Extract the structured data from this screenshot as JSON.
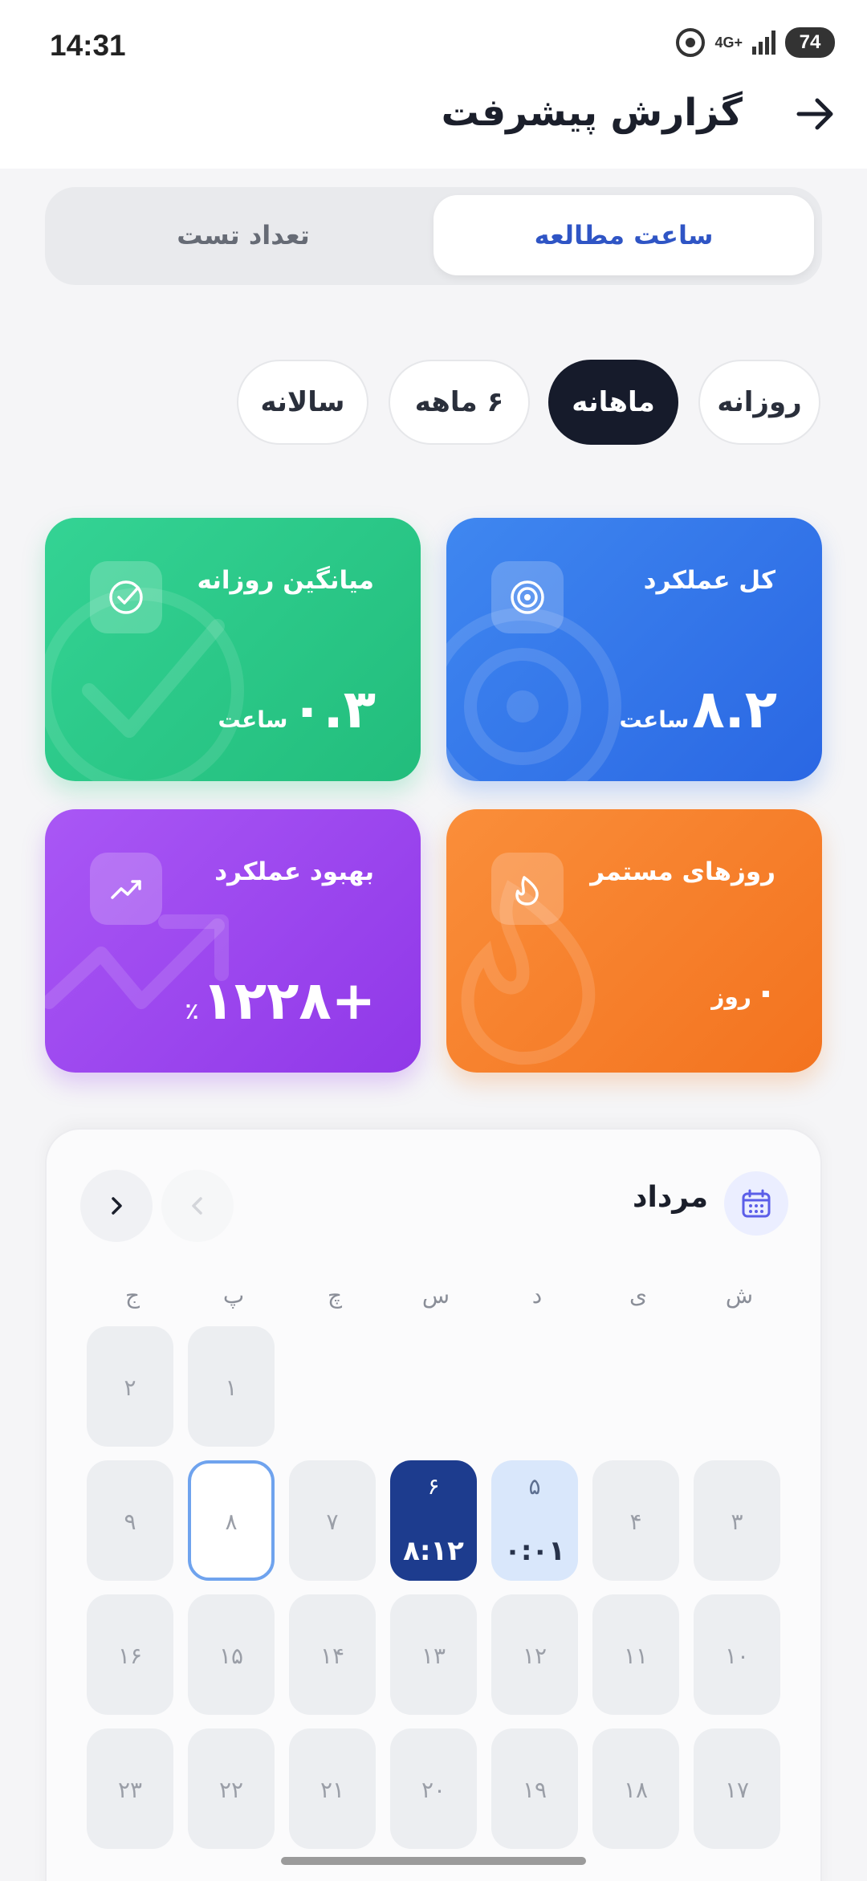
{
  "status": {
    "time": "14:31",
    "network": "4G+",
    "battery": "74"
  },
  "header": {
    "title": "گزارش پیشرفت"
  },
  "segment": {
    "active": "ساعت مطالعه",
    "inactive": "تعداد تست"
  },
  "periods": [
    "روزانه",
    "ماهانه",
    "۶ ماهه",
    "سالانه"
  ],
  "active_period": "ماهانه",
  "cards": {
    "total": {
      "label": "کل عملکرد",
      "value": "۸.۲",
      "unit": "ساعت",
      "color": "#3b7bea"
    },
    "average": {
      "label": "میانگین روزانه",
      "value": "۰.۳",
      "unit": "ساعت",
      "color": "#2ecb88"
    },
    "streak": {
      "label": "روزهای مستمر",
      "value": "۰",
      "unit": "روز",
      "color": "#f5822b"
    },
    "improvement": {
      "label": "بهبود عملکرد",
      "value": "+۱۲۲۸",
      "unit": "٪",
      "color": "#9b45ee"
    }
  },
  "calendar": {
    "month": "مرداد",
    "weekdays": [
      "ش",
      "ی",
      "د",
      "س",
      "چ",
      "پ",
      "ج"
    ],
    "days": {
      "d1": "۱",
      "d2": "۲",
      "d3": "۳",
      "d4": "۴",
      "d5": "۵",
      "d6": "۶",
      "d7": "۷",
      "d8": "۸",
      "d9": "۹",
      "d10": "۱۰",
      "d11": "۱۱",
      "d12": "۱۲",
      "d13": "۱۳",
      "d14": "۱۴",
      "d15": "۱۵",
      "d16": "۱۶",
      "d17": "۱۷",
      "d18": "۱۸",
      "d19": "۱۹",
      "d20": "۲۰",
      "d21": "۲۱",
      "d22": "۲۲",
      "d23": "۲۳"
    },
    "times": {
      "d5": "۰:۰۱",
      "d6": "۸:۱۲"
    },
    "selected_day": "۸"
  }
}
